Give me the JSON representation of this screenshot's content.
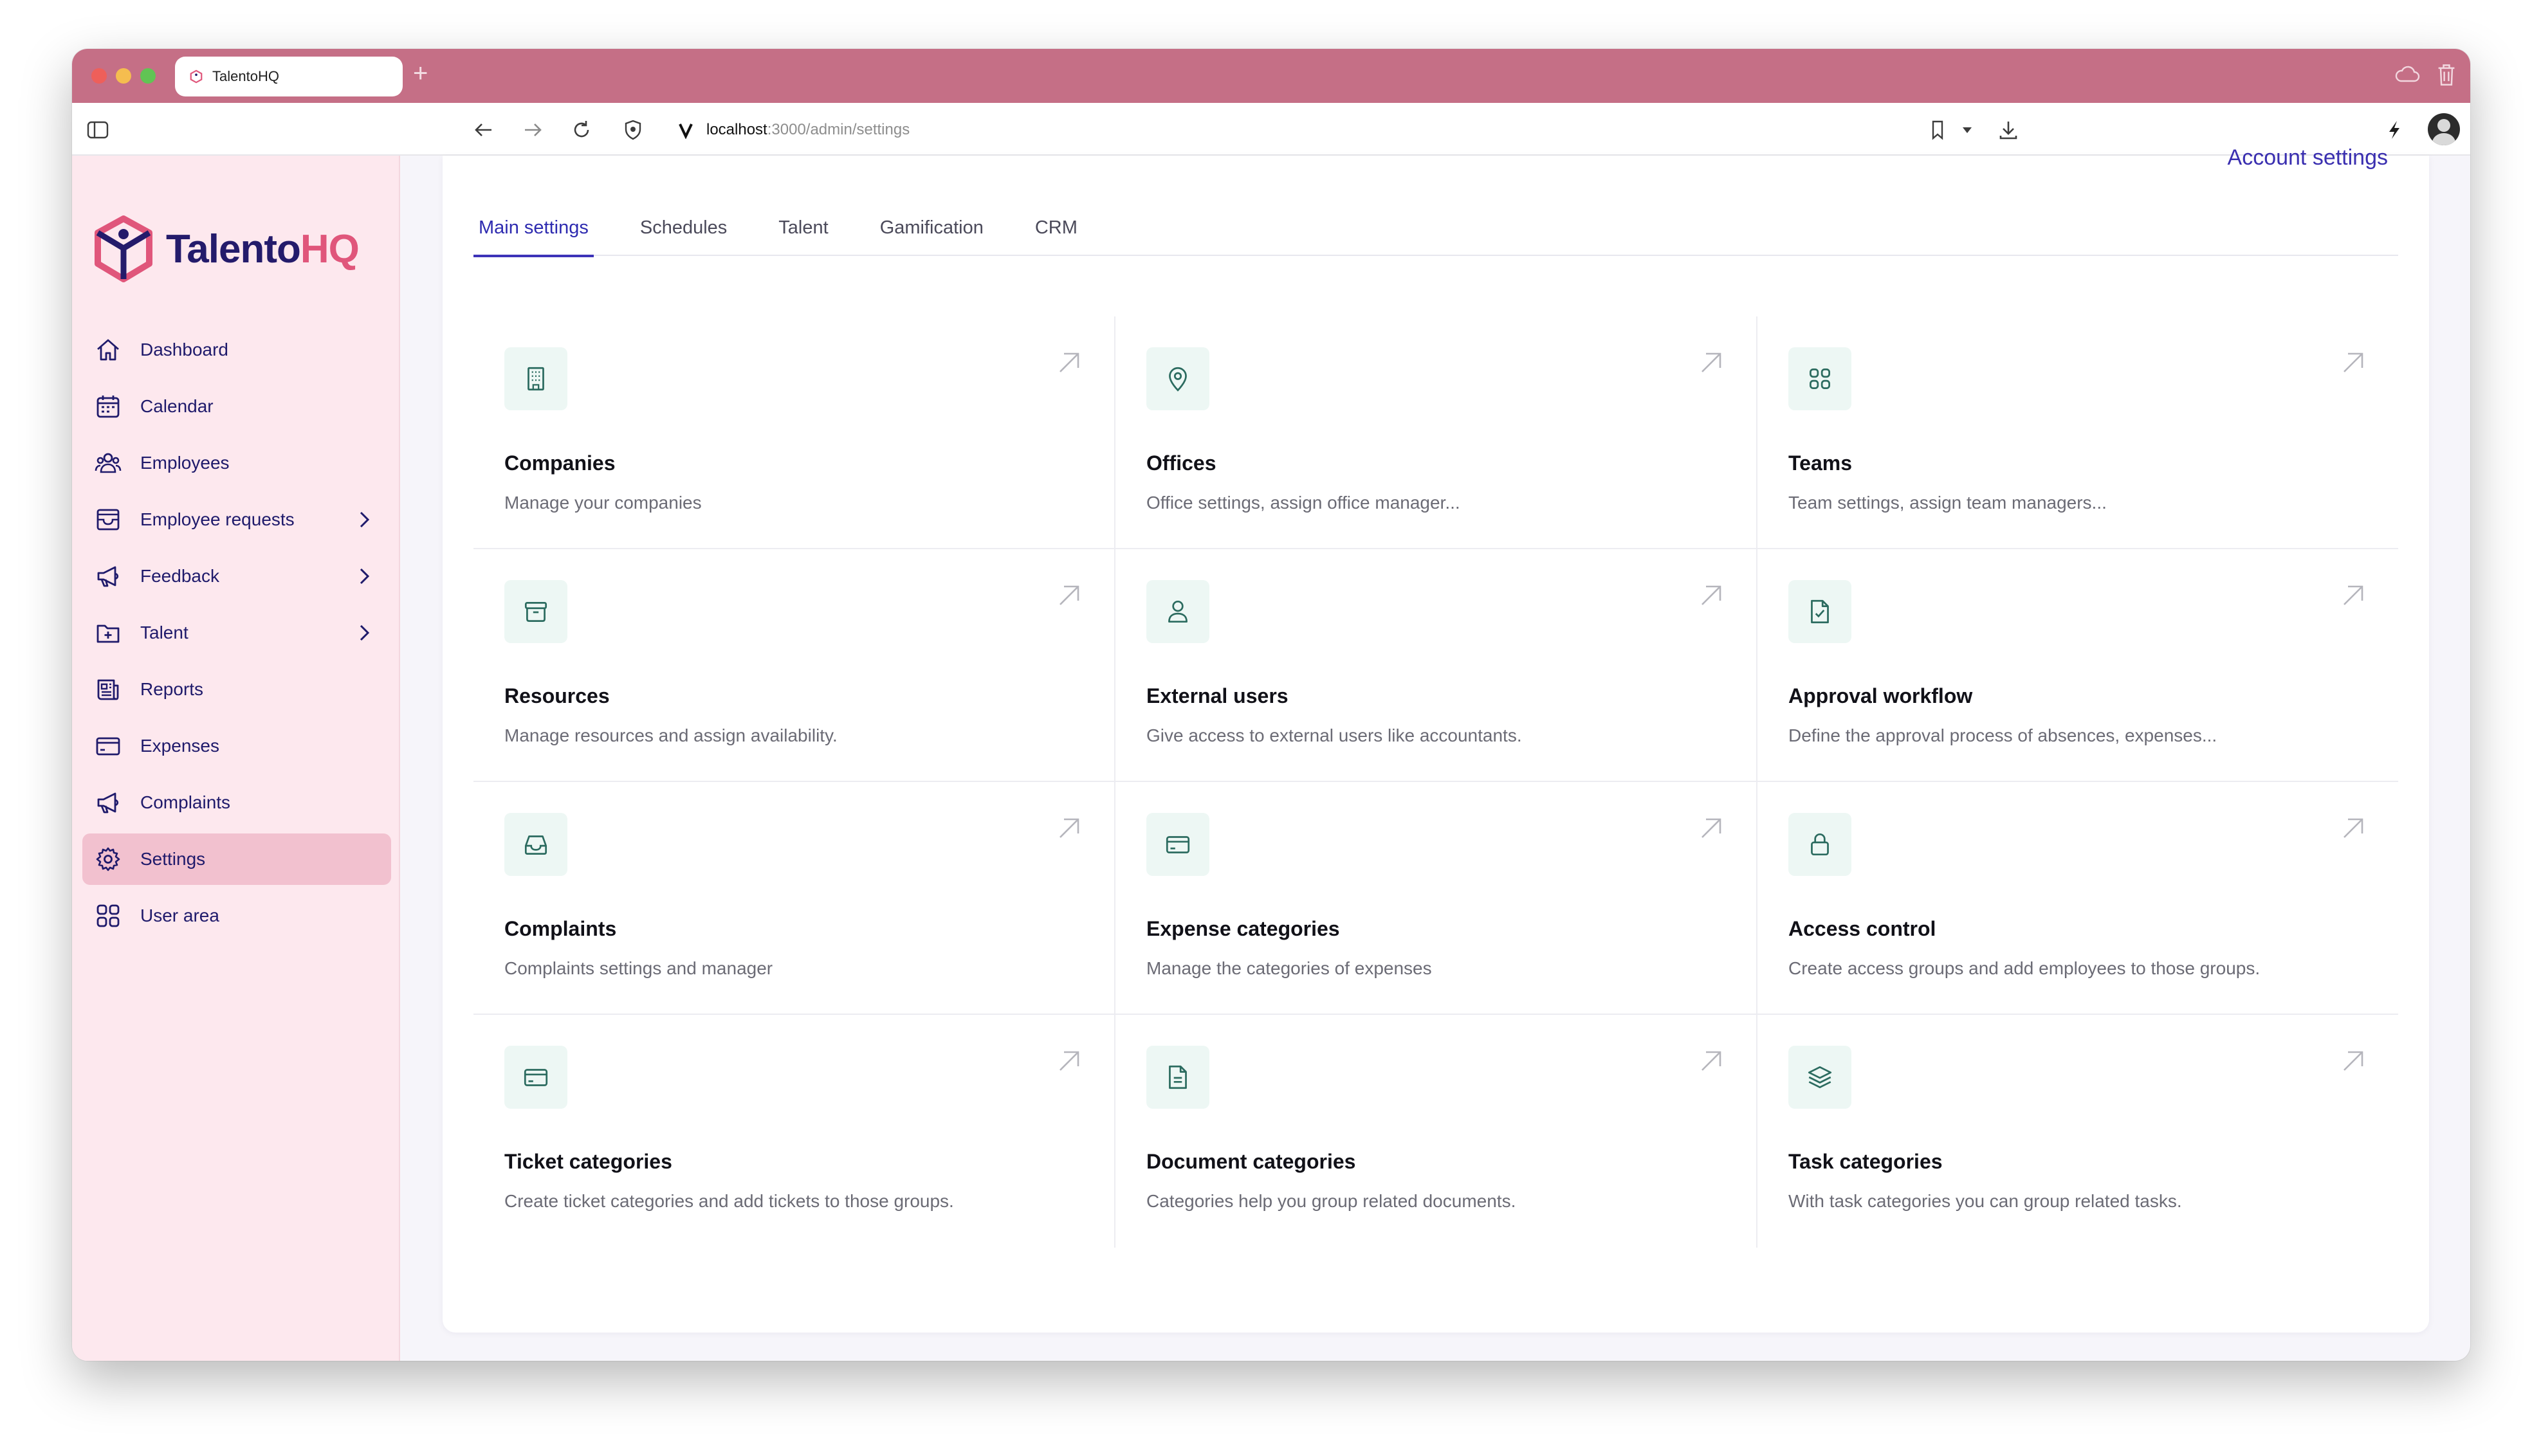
{
  "browser": {
    "tab_title": "TalentoHQ",
    "url_host": "localhost",
    "url_path": ":3000/admin/settings"
  },
  "brand": {
    "part1": "Talento",
    "part2": "HQ"
  },
  "sidebar": {
    "items": [
      {
        "label": "Dashboard",
        "icon": "home-icon"
      },
      {
        "label": "Calendar",
        "icon": "calendar-icon"
      },
      {
        "label": "Employees",
        "icon": "users-icon"
      },
      {
        "label": "Employee requests",
        "icon": "inbox-icon",
        "has_submenu": true
      },
      {
        "label": "Feedback",
        "icon": "megaphone-icon",
        "has_submenu": true
      },
      {
        "label": "Talent",
        "icon": "folder-plus-icon",
        "has_submenu": true
      },
      {
        "label": "Reports",
        "icon": "newspaper-icon"
      },
      {
        "label": "Expenses",
        "icon": "credit-card-icon"
      },
      {
        "label": "Complaints",
        "icon": "megaphone-icon"
      },
      {
        "label": "Settings",
        "icon": "gear-icon",
        "active": true
      },
      {
        "label": "User area",
        "icon": "grid-icon"
      }
    ]
  },
  "header": {
    "account_link": "Account settings"
  },
  "tabs": [
    "Main settings",
    "Schedules",
    "Talent",
    "Gamification",
    "CRM"
  ],
  "active_tab": "Main settings",
  "cards": [
    {
      "title": "Companies",
      "desc": "Manage your companies",
      "icon": "building-icon"
    },
    {
      "title": "Offices",
      "desc": "Office settings, assign office manager...",
      "icon": "map-pin-icon"
    },
    {
      "title": "Teams",
      "desc": "Team settings, assign team managers...",
      "icon": "grid-icon"
    },
    {
      "title": "Resources",
      "desc": "Manage resources and assign availability.",
      "icon": "archive-box-icon"
    },
    {
      "title": "External users",
      "desc": "Give access to external users like accountants.",
      "icon": "user-icon"
    },
    {
      "title": "Approval workflow",
      "desc": "Define the approval process of absences, expenses...",
      "icon": "document-check-icon"
    },
    {
      "title": "Complaints",
      "desc": "Complaints settings and manager",
      "icon": "inbox-tray-icon"
    },
    {
      "title": "Expense categories",
      "desc": "Manage the categories of expenses",
      "icon": "credit-card-icon"
    },
    {
      "title": "Access control",
      "desc": "Create access groups and add employees to those groups.",
      "icon": "lock-icon"
    },
    {
      "title": "Ticket categories",
      "desc": "Create ticket categories and add tickets to those groups.",
      "icon": "credit-card-icon"
    },
    {
      "title": "Document categories",
      "desc": "Categories help you group related documents.",
      "icon": "document-icon"
    },
    {
      "title": "Task categories",
      "desc": "With task categories you can group related tasks.",
      "icon": "layers-icon"
    }
  ],
  "colors": {
    "tab_bar": "#c56f86",
    "sidebar_bg": "#fde8ee",
    "active_nav": "#f2c1cf",
    "nav_text": "#1f1a6b",
    "accent": "#3d33b8",
    "icon_green": "#2b6b5f",
    "icon_box": "#edf7f4"
  }
}
